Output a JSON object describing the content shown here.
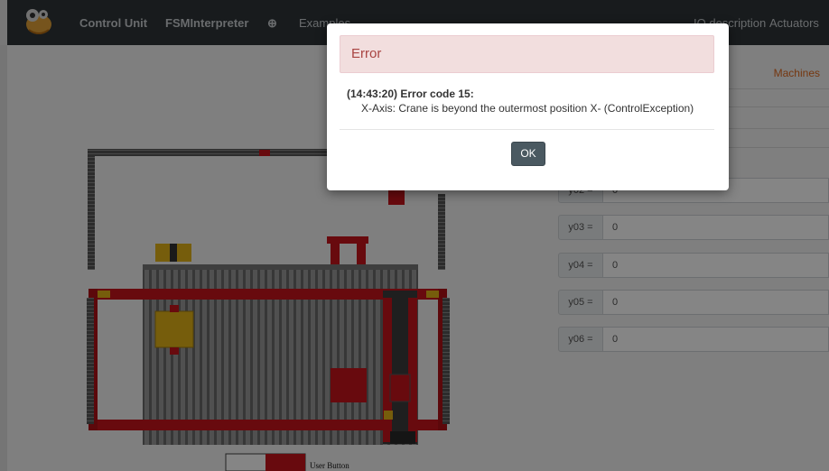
{
  "navbar": {
    "items": [
      {
        "label": "Control Unit"
      },
      {
        "label": "FSMInterpreter"
      },
      {
        "label": "⊕"
      },
      {
        "label": "Examples"
      },
      {
        "label": "IO description"
      },
      {
        "label": "Actuators"
      }
    ]
  },
  "panel": {
    "machines_tab": "Machines",
    "rows": [
      {
        "label": "y02 =",
        "value": "0"
      },
      {
        "label": "y03 =",
        "value": "0"
      },
      {
        "label": "y04 =",
        "value": "0"
      },
      {
        "label": "y05 =",
        "value": "0"
      },
      {
        "label": "y06 =",
        "value": "0"
      }
    ]
  },
  "simulation": {
    "user_button_label": "User Button"
  },
  "modal": {
    "title": "Error",
    "heading": "(14:43:20) Error code 15:",
    "message": "X-Axis: Crane is beyond the outermost position X- (ControlException)",
    "ok_label": "OK"
  },
  "colors": {
    "navbar": "#2e3539",
    "error_bg": "#f2dede",
    "error_text": "#a94442",
    "ok_button": "#4a5961",
    "frame_red": "#c8141b",
    "machines_tab": "#e06a20"
  }
}
